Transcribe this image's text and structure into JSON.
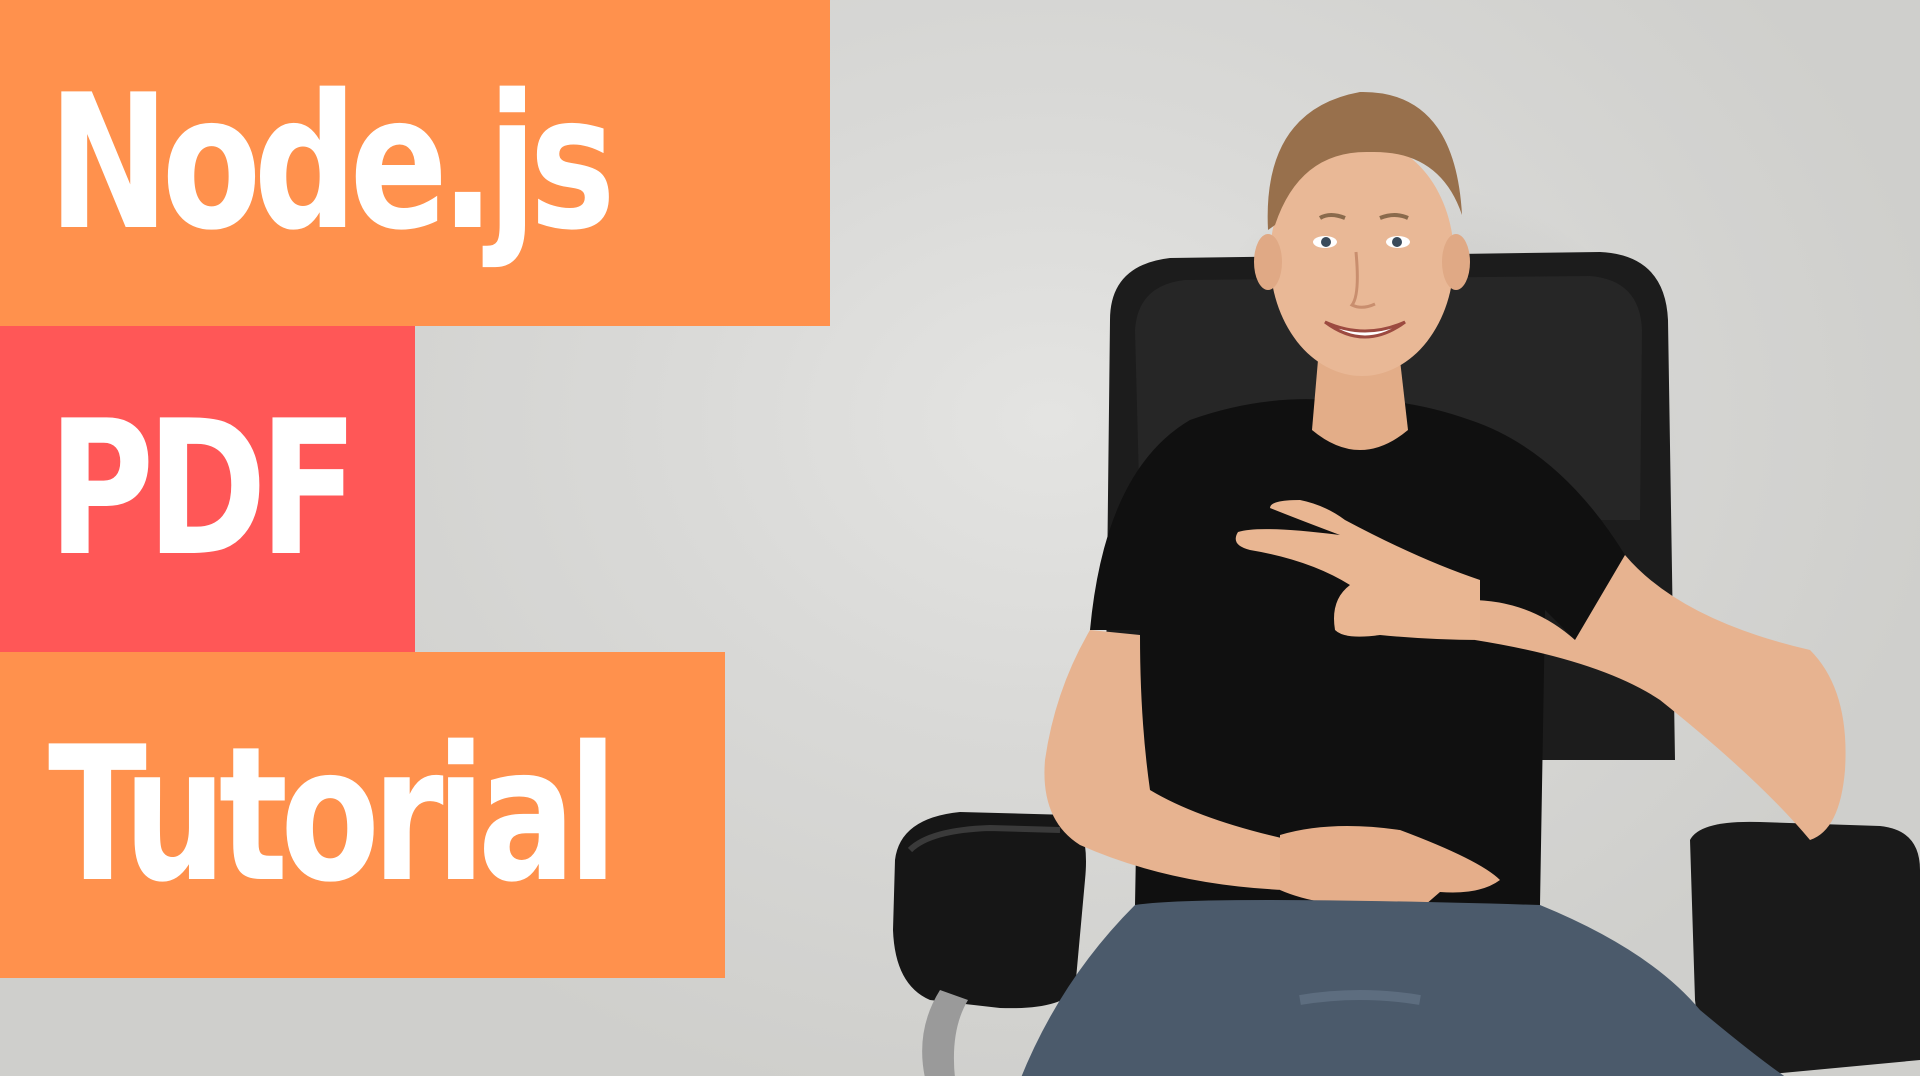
{
  "title_lines": {
    "line1": "Node.js",
    "line2": "PDF",
    "line3": "Tutorial"
  },
  "colors": {
    "orange": "#ff914d",
    "red": "#ff5757",
    "text": "#ffffff",
    "chair": "#1c1c1c",
    "shirt": "#111111",
    "jeans": "#4a5868",
    "skin": "#e8b48f",
    "hair": "#9a7350"
  }
}
